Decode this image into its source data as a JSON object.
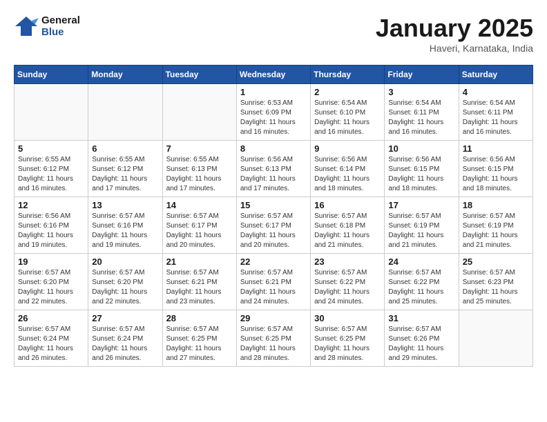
{
  "logo": {
    "line1": "General",
    "line2": "Blue"
  },
  "title": "January 2025",
  "subtitle": "Haveri, Karnataka, India",
  "days_of_week": [
    "Sunday",
    "Monday",
    "Tuesday",
    "Wednesday",
    "Thursday",
    "Friday",
    "Saturday"
  ],
  "weeks": [
    [
      {
        "day": "",
        "info": ""
      },
      {
        "day": "",
        "info": ""
      },
      {
        "day": "",
        "info": ""
      },
      {
        "day": "1",
        "info": "Sunrise: 6:53 AM\nSunset: 6:09 PM\nDaylight: 11 hours and 16 minutes."
      },
      {
        "day": "2",
        "info": "Sunrise: 6:54 AM\nSunset: 6:10 PM\nDaylight: 11 hours and 16 minutes."
      },
      {
        "day": "3",
        "info": "Sunrise: 6:54 AM\nSunset: 6:11 PM\nDaylight: 11 hours and 16 minutes."
      },
      {
        "day": "4",
        "info": "Sunrise: 6:54 AM\nSunset: 6:11 PM\nDaylight: 11 hours and 16 minutes."
      }
    ],
    [
      {
        "day": "5",
        "info": "Sunrise: 6:55 AM\nSunset: 6:12 PM\nDaylight: 11 hours and 16 minutes."
      },
      {
        "day": "6",
        "info": "Sunrise: 6:55 AM\nSunset: 6:12 PM\nDaylight: 11 hours and 17 minutes."
      },
      {
        "day": "7",
        "info": "Sunrise: 6:55 AM\nSunset: 6:13 PM\nDaylight: 11 hours and 17 minutes."
      },
      {
        "day": "8",
        "info": "Sunrise: 6:56 AM\nSunset: 6:13 PM\nDaylight: 11 hours and 17 minutes."
      },
      {
        "day": "9",
        "info": "Sunrise: 6:56 AM\nSunset: 6:14 PM\nDaylight: 11 hours and 18 minutes."
      },
      {
        "day": "10",
        "info": "Sunrise: 6:56 AM\nSunset: 6:15 PM\nDaylight: 11 hours and 18 minutes."
      },
      {
        "day": "11",
        "info": "Sunrise: 6:56 AM\nSunset: 6:15 PM\nDaylight: 11 hours and 18 minutes."
      }
    ],
    [
      {
        "day": "12",
        "info": "Sunrise: 6:56 AM\nSunset: 6:16 PM\nDaylight: 11 hours and 19 minutes."
      },
      {
        "day": "13",
        "info": "Sunrise: 6:57 AM\nSunset: 6:16 PM\nDaylight: 11 hours and 19 minutes."
      },
      {
        "day": "14",
        "info": "Sunrise: 6:57 AM\nSunset: 6:17 PM\nDaylight: 11 hours and 20 minutes."
      },
      {
        "day": "15",
        "info": "Sunrise: 6:57 AM\nSunset: 6:17 PM\nDaylight: 11 hours and 20 minutes."
      },
      {
        "day": "16",
        "info": "Sunrise: 6:57 AM\nSunset: 6:18 PM\nDaylight: 11 hours and 21 minutes."
      },
      {
        "day": "17",
        "info": "Sunrise: 6:57 AM\nSunset: 6:19 PM\nDaylight: 11 hours and 21 minutes."
      },
      {
        "day": "18",
        "info": "Sunrise: 6:57 AM\nSunset: 6:19 PM\nDaylight: 11 hours and 21 minutes."
      }
    ],
    [
      {
        "day": "19",
        "info": "Sunrise: 6:57 AM\nSunset: 6:20 PM\nDaylight: 11 hours and 22 minutes."
      },
      {
        "day": "20",
        "info": "Sunrise: 6:57 AM\nSunset: 6:20 PM\nDaylight: 11 hours and 22 minutes."
      },
      {
        "day": "21",
        "info": "Sunrise: 6:57 AM\nSunset: 6:21 PM\nDaylight: 11 hours and 23 minutes."
      },
      {
        "day": "22",
        "info": "Sunrise: 6:57 AM\nSunset: 6:21 PM\nDaylight: 11 hours and 24 minutes."
      },
      {
        "day": "23",
        "info": "Sunrise: 6:57 AM\nSunset: 6:22 PM\nDaylight: 11 hours and 24 minutes."
      },
      {
        "day": "24",
        "info": "Sunrise: 6:57 AM\nSunset: 6:22 PM\nDaylight: 11 hours and 25 minutes."
      },
      {
        "day": "25",
        "info": "Sunrise: 6:57 AM\nSunset: 6:23 PM\nDaylight: 11 hours and 25 minutes."
      }
    ],
    [
      {
        "day": "26",
        "info": "Sunrise: 6:57 AM\nSunset: 6:24 PM\nDaylight: 11 hours and 26 minutes."
      },
      {
        "day": "27",
        "info": "Sunrise: 6:57 AM\nSunset: 6:24 PM\nDaylight: 11 hours and 26 minutes."
      },
      {
        "day": "28",
        "info": "Sunrise: 6:57 AM\nSunset: 6:25 PM\nDaylight: 11 hours and 27 minutes."
      },
      {
        "day": "29",
        "info": "Sunrise: 6:57 AM\nSunset: 6:25 PM\nDaylight: 11 hours and 28 minutes."
      },
      {
        "day": "30",
        "info": "Sunrise: 6:57 AM\nSunset: 6:25 PM\nDaylight: 11 hours and 28 minutes."
      },
      {
        "day": "31",
        "info": "Sunrise: 6:57 AM\nSunset: 6:26 PM\nDaylight: 11 hours and 29 minutes."
      },
      {
        "day": "",
        "info": ""
      }
    ]
  ]
}
